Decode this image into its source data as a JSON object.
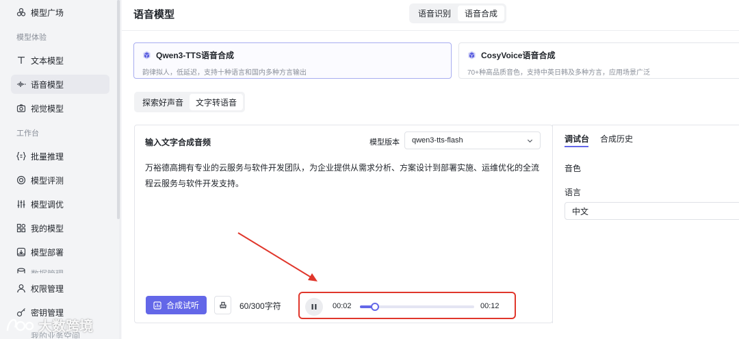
{
  "sidebar": {
    "top_item": "模型广场",
    "section_experience": "模型体验",
    "section_workbench": "工作台",
    "items": [
      {
        "label": "文本模型",
        "icon": "text-icon"
      },
      {
        "label": "语音模型",
        "icon": "waveform-icon"
      },
      {
        "label": "视觉模型",
        "icon": "camera-icon"
      },
      {
        "label": "批量推理",
        "icon": "braces-icon"
      },
      {
        "label": "模型评测",
        "icon": "target-icon"
      },
      {
        "label": "模型调优",
        "icon": "sliders-icon"
      },
      {
        "label": "我的模型",
        "icon": "grid-icon"
      },
      {
        "label": "模型部署",
        "icon": "deploy-icon"
      },
      {
        "label": "数据管理",
        "icon": "database-icon"
      },
      {
        "label": "权限管理",
        "icon": "user-icon"
      },
      {
        "label": "密钥管理",
        "icon": "key-icon"
      },
      {
        "label": "我的业务空间",
        "icon": "space-icon"
      }
    ],
    "active_item": "语音模型"
  },
  "header": {
    "title": "语音模型",
    "tabs": [
      "语音识别",
      "语音合成"
    ],
    "active_tab": "语音合成"
  },
  "model_cards": [
    {
      "title": "Qwen3-TTS语音合成",
      "desc": "韵律拟人，低延迟，支持十种语言和国内多种方言输出",
      "selected": true
    },
    {
      "title": "CosyVoice语音合成",
      "desc": "70+种高品质音色，支持中英日韩及多种方言，应用场景广泛",
      "selected": false
    }
  ],
  "sub_tabs": [
    "探索好声音",
    "文字转语音"
  ],
  "active_sub_tab": "文字转语音",
  "synth_panel": {
    "title": "输入文字合成音频",
    "version_label": "模型版本",
    "version_value": "qwen3-tts-flash",
    "text": "万裕德高拥有专业的云服务与软件开发团队，为企业提供从需求分析、方案设计到部署实施、运维优化的全流程云服务与软件开发支持。",
    "synth_button": "合成试听",
    "char_count": "60/300字符"
  },
  "player": {
    "current": "00:02",
    "total": "00:12",
    "progress": 0.13
  },
  "right_panel": {
    "tabs": [
      "调试台",
      "合成历史"
    ],
    "active_tab": "调试台",
    "voice_label": "音色",
    "language_label": "语言",
    "language_value": "中文"
  },
  "annotation": {
    "color": "#e0362b"
  },
  "watermark": "大数跨境",
  "colors": {
    "accent": "#6367e8",
    "highlight": "#e0362b"
  }
}
